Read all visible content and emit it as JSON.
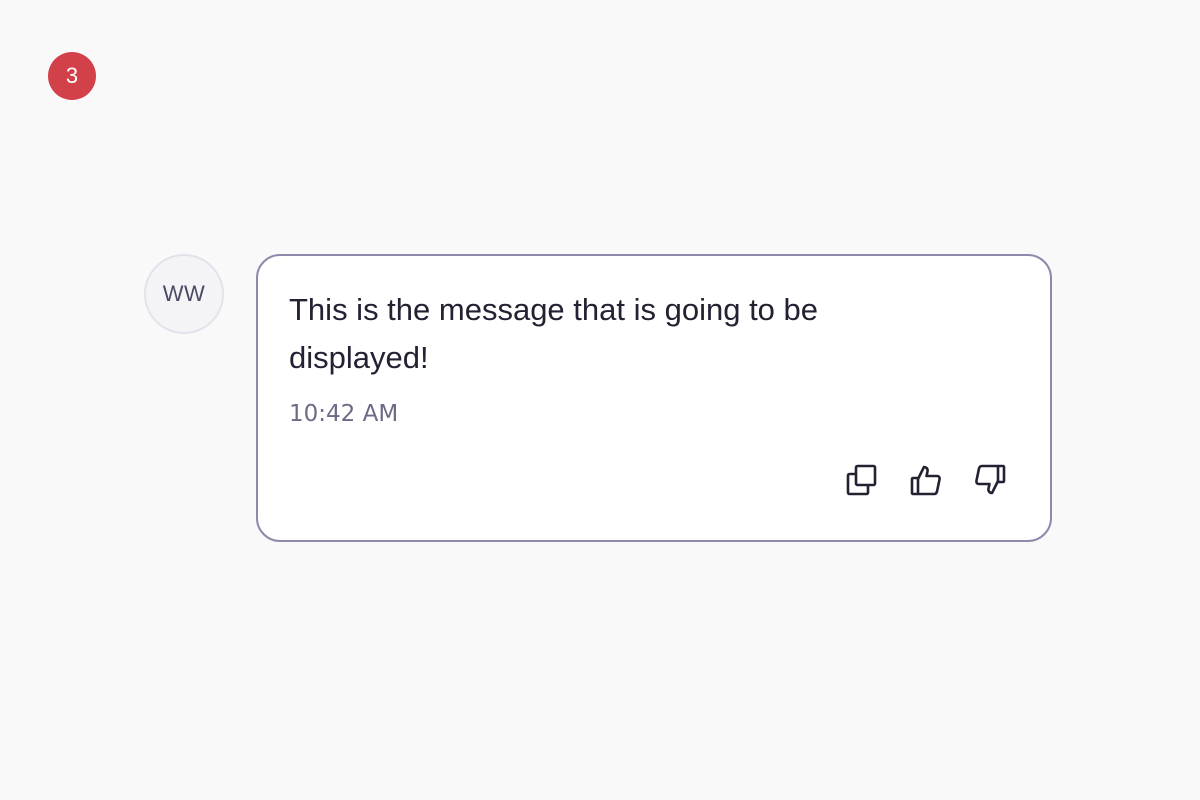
{
  "step_badge": {
    "label": "3",
    "color": "#d2404a"
  },
  "avatar": {
    "initials": "WW"
  },
  "message": {
    "text": "This is the message that is going to be displayed!",
    "timestamp": "10:42 AM"
  },
  "actions": [
    {
      "name": "copy",
      "icon": "copy-icon"
    },
    {
      "name": "thumbs-up",
      "icon": "thumbs-up-icon"
    },
    {
      "name": "thumbs-down",
      "icon": "thumbs-down-icon"
    }
  ],
  "colors": {
    "background": "#f9f9fa",
    "bubble_border": "#8f8aac",
    "text": "#222233",
    "timestamp": "#6c6a84"
  }
}
